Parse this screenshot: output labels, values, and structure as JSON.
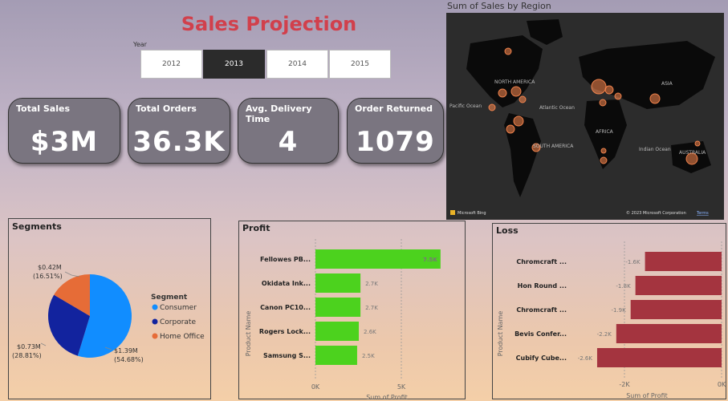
{
  "title": "Sales Projection",
  "year_filter": {
    "label": "Year",
    "options": [
      "2012",
      "2013",
      "2014",
      "2015"
    ],
    "selected": "2013"
  },
  "kpis": [
    {
      "label": "Total Sales",
      "value": "$3M"
    },
    {
      "label": "Total Orders",
      "value": "36.3K"
    },
    {
      "label": "Avg. Delivery Time",
      "value": "4"
    },
    {
      "label": "Order Returned",
      "value": "1079"
    }
  ],
  "map": {
    "title": "Sum of Sales by Region",
    "labels": [
      "NORTH AMERICA",
      "ASIA",
      "Atlantic Ocean",
      "AFRICA",
      "SOUTH AMERICA",
      "Indian Ocean",
      "AUSTRALIA",
      "Pacific Ocean"
    ],
    "attribution_left": "Microsoft Bing",
    "attribution_right": "© 2023 Microsoft Corporation",
    "terms": "Terms"
  },
  "segments": {
    "title": "Segments",
    "legend_title": "Segment",
    "slice_labels": [
      {
        "value": "$1.39M",
        "pct": "(54.68%)"
      },
      {
        "value": "$0.73M",
        "pct": "(28.81%)"
      },
      {
        "value": "$0.42M",
        "pct": "(16.51%)"
      }
    ],
    "colors": {
      "consumer": "#118dff",
      "corporate": "#12239e",
      "home_office": "#e66c37"
    }
  },
  "profit": {
    "title": "Profit",
    "ylabel": "Product Name",
    "xlabel": "Sum of Profit",
    "ticks": [
      "0K",
      "5K"
    ],
    "color": "#4cd21e"
  },
  "loss": {
    "title": "Loss",
    "ylabel": "Product Name",
    "xlabel": "Sum of Profit",
    "ticks": [
      "-2K",
      "0K"
    ],
    "color": "#a4343f"
  },
  "chart_data": [
    {
      "type": "pie",
      "title": "Segments",
      "categories": [
        "Consumer",
        "Corporate",
        "Home Office"
      ],
      "values": [
        1.39,
        0.73,
        0.42
      ],
      "percentages": [
        54.68,
        28.81,
        16.51
      ],
      "legend": "right"
    },
    {
      "type": "bar",
      "title": "Profit",
      "orientation": "horizontal",
      "categories": [
        "Fellowes PB...",
        "Okidata Ink...",
        "Canon PC10...",
        "Rogers Lock...",
        "Samsung S..."
      ],
      "values": [
        7500,
        2700,
        2700,
        2600,
        2500
      ],
      "value_labels": [
        "7.5K",
        "2.7K",
        "2.7K",
        "2.6K",
        "2.5K"
      ],
      "xlabel": "Sum of Profit",
      "ylabel": "Product Name",
      "xlim": [
        0,
        7700
      ]
    },
    {
      "type": "bar",
      "title": "Loss",
      "orientation": "horizontal",
      "categories": [
        "Chromcraft ...",
        "Hon Round ...",
        "Chromcraft ...",
        "Bevis Confer...",
        "Cubify Cube..."
      ],
      "values": [
        -1600,
        -1800,
        -1900,
        -2200,
        -2600
      ],
      "value_labels": [
        "-1.6K",
        "-1.8K",
        "-1.9K",
        "-2.2K",
        "-2.6K"
      ],
      "xlabel": "Sum of Profit",
      "ylabel": "Product Name",
      "xlim": [
        -2700,
        0
      ]
    }
  ]
}
